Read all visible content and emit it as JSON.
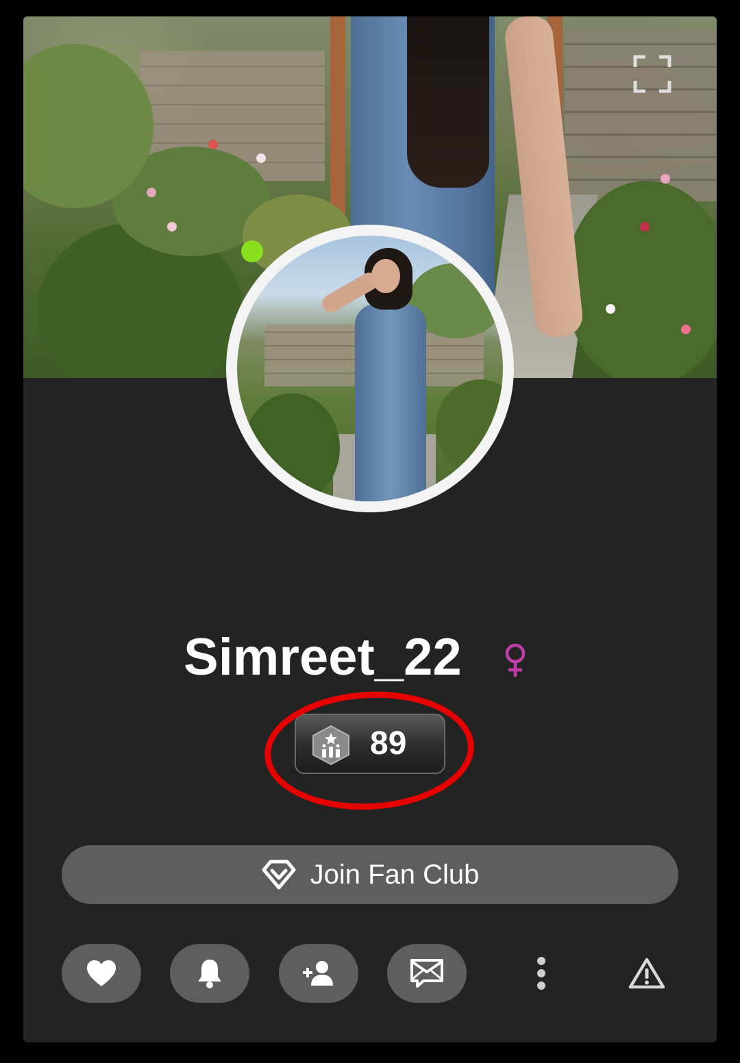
{
  "profile": {
    "username": "Simreet_22",
    "gender_icon": "female-symbol-icon",
    "online": true,
    "level": "89",
    "level_icon": "level-badge-icon"
  },
  "actions": {
    "join_label": "Join Fan Club",
    "join_icon": "diamond-icon",
    "buttons": [
      {
        "name": "like",
        "icon": "heart-icon"
      },
      {
        "name": "notify",
        "icon": "bell-icon"
      },
      {
        "name": "follow",
        "icon": "add-user-icon"
      },
      {
        "name": "message",
        "icon": "envelope-icon"
      },
      {
        "name": "more",
        "icon": "more-vertical-icon"
      },
      {
        "name": "report",
        "icon": "warning-icon"
      }
    ]
  },
  "colors": {
    "card_bg": "#232323",
    "button_bg": "#5e5e5e",
    "online_dot": "#8ae01e",
    "gender_icon": "#c13fa8",
    "highlight": "#e60000"
  }
}
